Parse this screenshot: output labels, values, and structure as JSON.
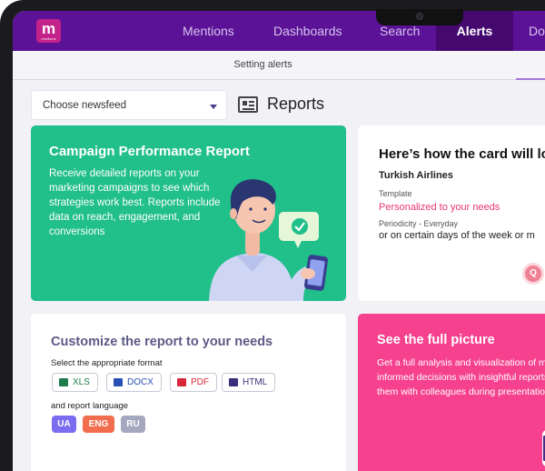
{
  "nav": {
    "logo_letter": "m",
    "logo_sub": "mentions",
    "items": [
      "Mentions",
      "Dashboards",
      "Search",
      "Alerts",
      "Do"
    ],
    "active": "Alerts"
  },
  "subnav": {
    "tab": "Setting alerts"
  },
  "toolbar": {
    "newsfeed_placeholder": "Choose newsfeed",
    "section_title": "Reports"
  },
  "campaign_card": {
    "title": "Campaign Performance Report",
    "body": "Receive detailed reports on your marketing campaigns to see which strategies work best. Reports include data on reach, engagement, and conversions"
  },
  "preview_card": {
    "title": "Here’s how the card will lo",
    "org": "Turkish Airlines",
    "template_label": "Template",
    "template_value": "Personalized to your needs",
    "periodicity_label": "Periodicity - Everyday",
    "periodicity_value": "or on certain days of the week or m",
    "badge": "Q"
  },
  "customize_card": {
    "title": "Customize the report to your needs",
    "format_label": "Select the appropriate format",
    "formats": [
      "XLS",
      "DOCX",
      "PDF",
      "HTML"
    ],
    "language_label": "and report language",
    "languages": [
      "UA",
      "ENG",
      "RU"
    ]
  },
  "picture_card": {
    "title": "See the full picture",
    "body": "Get a full analysis and visualization of monitoring data. Make informed decisions with insightful reports and clear charts, share them with colleagues during presentations"
  },
  "colors": {
    "nav_bg": "#5b1296",
    "nav_active_bg": "#44086f",
    "green_card": "#21bf8a",
    "pink_card": "#f5418e",
    "template_value": "#e8386b",
    "logo": "#c4228b",
    "xls": "#1f7a4c",
    "docx": "#2b4fb5",
    "pdf": "#d6283a",
    "html": "#3a2f7a",
    "ua": "#7a6ef0",
    "eng": "#f26d4d",
    "ru": "#a5a9bf"
  }
}
